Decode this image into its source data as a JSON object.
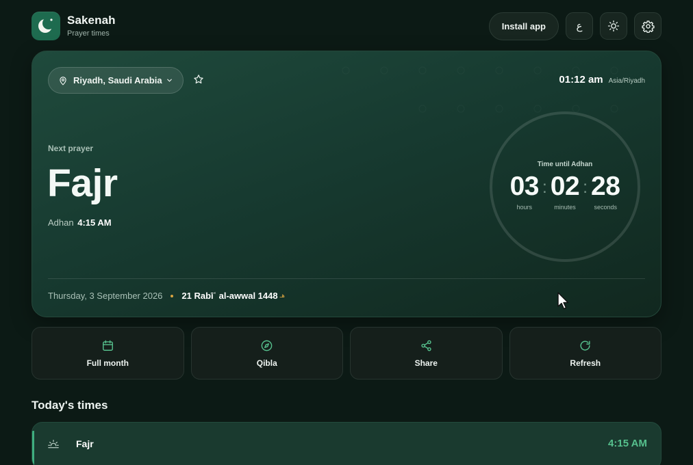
{
  "app": {
    "name": "Sakenah",
    "subtitle": "Prayer times"
  },
  "header": {
    "install_label": "Install app",
    "language_label": "ع",
    "icons": [
      "moon-logo",
      "sun-icon",
      "gear-icon"
    ]
  },
  "location": {
    "label": "Riyadh, Saudi Arabia",
    "time": "01:12 am",
    "timezone": "Asia/Riyadh"
  },
  "next_prayer": {
    "label": "Next prayer",
    "name": "Fajr",
    "adhan_label": "Adhan",
    "adhan_time": "4:15 AM"
  },
  "countdown": {
    "title": "Time until Adhan",
    "hours": "03",
    "minutes": "02",
    "seconds": "28",
    "hours_label": "hours",
    "minutes_label": "minutes",
    "seconds_label": "seconds",
    "separator": ":"
  },
  "dates": {
    "gregorian": "Thursday, 3 September 2026",
    "hijri": "21 Rabīʿ al-awwal 1448",
    "hijri_suffix": "هـ"
  },
  "actions": [
    {
      "label": "Full month",
      "icon": "calendar-icon"
    },
    {
      "label": "Qibla",
      "icon": "compass-icon"
    },
    {
      "label": "Share",
      "icon": "share-icon"
    },
    {
      "label": "Refresh",
      "icon": "refresh-icon"
    }
  ],
  "today": {
    "title": "Today's times",
    "rows": [
      {
        "name": "Fajr",
        "time": "4:15 AM",
        "icon": "sunrise-icon"
      }
    ]
  },
  "colors": {
    "accent": "#3fae7f",
    "accent_text": "#56c08d",
    "gold": "#d9a441",
    "background": "#0c1a15"
  }
}
